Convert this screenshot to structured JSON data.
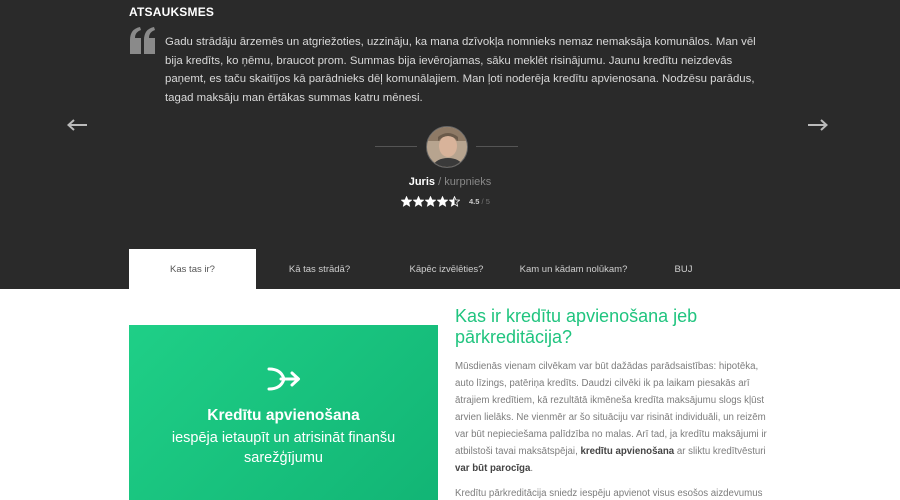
{
  "testimonials": {
    "title": "ATSAUKSMES",
    "quote": "Gadu strādāju ārzemēs un atgriežoties, uzzināju, ka mana dzīvokļa nomnieks nemaz nemaksāja komunālos. Man vēl bija kredīts, ko ņēmu, braucot prom. Summas bija ievērojamas, sāku meklēt risinājumu. Jaunu kredītu neizdevās paņemt, es taču skaitījos kā parādnieks dēļ komunālajiem. Man ļoti noderēja kredītu apvienosana. Nodzēsu parādus, tagad maksāju man ērtākas summas katru mēnesi.",
    "author_name": "Juris",
    "separator": " / ",
    "author_role": "kurpnieks",
    "rating": 4.5,
    "rating_value": "4.5",
    "rating_max": " / 5",
    "icons": {
      "quote": "quote-icon",
      "prev": "arrow-left-icon",
      "next": "arrow-right-icon"
    }
  },
  "tabs": [
    {
      "label": "Kas tas ir?",
      "active": true
    },
    {
      "label": "Kā tas strādā?",
      "active": false
    },
    {
      "label": "Kāpēc izvēlēties?",
      "active": false
    },
    {
      "label": "Kam un kādam nolūkam?",
      "active": false
    },
    {
      "label": "BUJ",
      "active": false
    }
  ],
  "promo": {
    "icon": "merge-arrows-icon",
    "title": "Kredītu apvienošana",
    "subtitle": "iespēja ietaupīt un atrisināt finanšu sarežģījumu"
  },
  "content": {
    "heading": "Kas ir kredītu apvienošana jeb pārkreditācija?",
    "p1_a": "Mūsdienās vienam cilvēkam var būt dažādas parādsaistības: hipotēka, auto līzings, patēriņa kredīts. Daudzi cilvēki ik pa laikam piesakās arī ātrajiem kredītiem, kā rezultātā ikmēneša kredīta maksājumu slogs kļūst arvien lielāks. Ne vienmēr ar šo situāciju var risināt individuāli, un reizēm var būt nepieciešama palīdzība no malas. Arī tad, ja kredītu maksājumi ir atbilstoši tavai maksātspējai,",
    "p1_bold1": "kredītu apvienošana",
    "p1_b": "ar sliktu kredītvēsturi",
    "p1_bold2": "var būt parocīga",
    "p1_end": ".",
    "p2": "Kredītu pārkreditācija sniedz iespēju apvienot visus esošos aizdevumus vienā. Tā vietā, lai ik mēnesi maksātu dažādiem aizdevējiem, tērējot"
  },
  "colors": {
    "dark_bg": "#2a2a2a",
    "accent_green": "#20c47f",
    "tab_active_bg": "#ffffff"
  }
}
